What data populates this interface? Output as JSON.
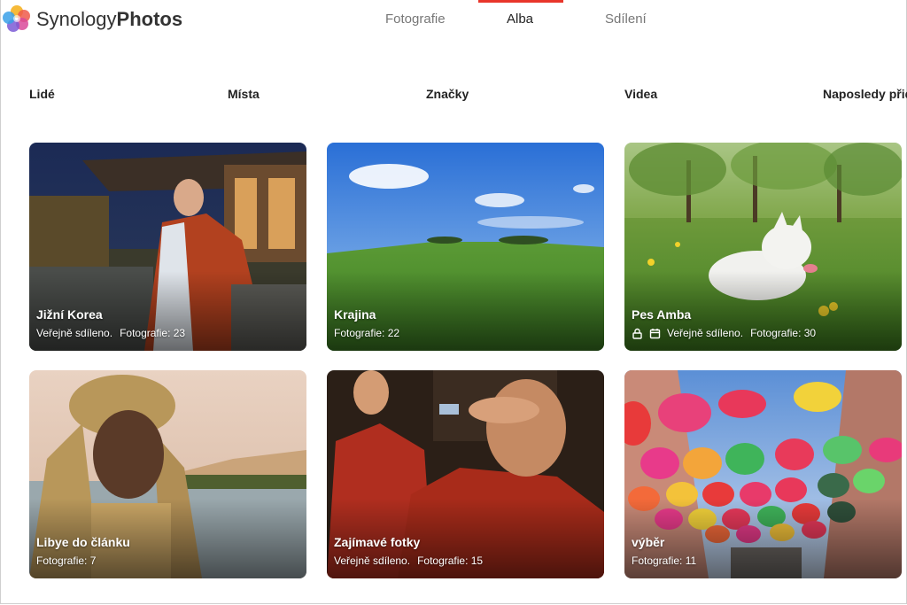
{
  "app": {
    "brand_part1": "Synology",
    "brand_part2": "Photos"
  },
  "tabs": [
    {
      "label": "Fotografie",
      "active": false
    },
    {
      "label": "Alba",
      "active": true
    },
    {
      "label": "Sdílení",
      "active": false
    }
  ],
  "categories": [
    {
      "label": "Lidé"
    },
    {
      "label": "Místa"
    },
    {
      "label": "Značky"
    },
    {
      "label": "Videa"
    },
    {
      "label": "Naposledy přid"
    }
  ],
  "albums": [
    {
      "title": "Jižní Korea",
      "shared": "Veřejně sdíleno.",
      "count": "Fotografie: 23"
    },
    {
      "title": "Krajina",
      "shared": "",
      "count": "Fotografie: 22"
    },
    {
      "title": "Pes Amba",
      "shared": "Veřejně sdíleno.",
      "count": "Fotografie: 30"
    },
    {
      "title": "Libye do článku",
      "shared": "",
      "count": "Fotografie: 7"
    },
    {
      "title": "Zajímavé fotky",
      "shared": "Veřejně sdíleno.",
      "count": "Fotografie: 15"
    },
    {
      "title": "výběr",
      "shared": "",
      "count": "Fotografie: 11"
    }
  ],
  "colors": {
    "accent": "#e8352a"
  }
}
